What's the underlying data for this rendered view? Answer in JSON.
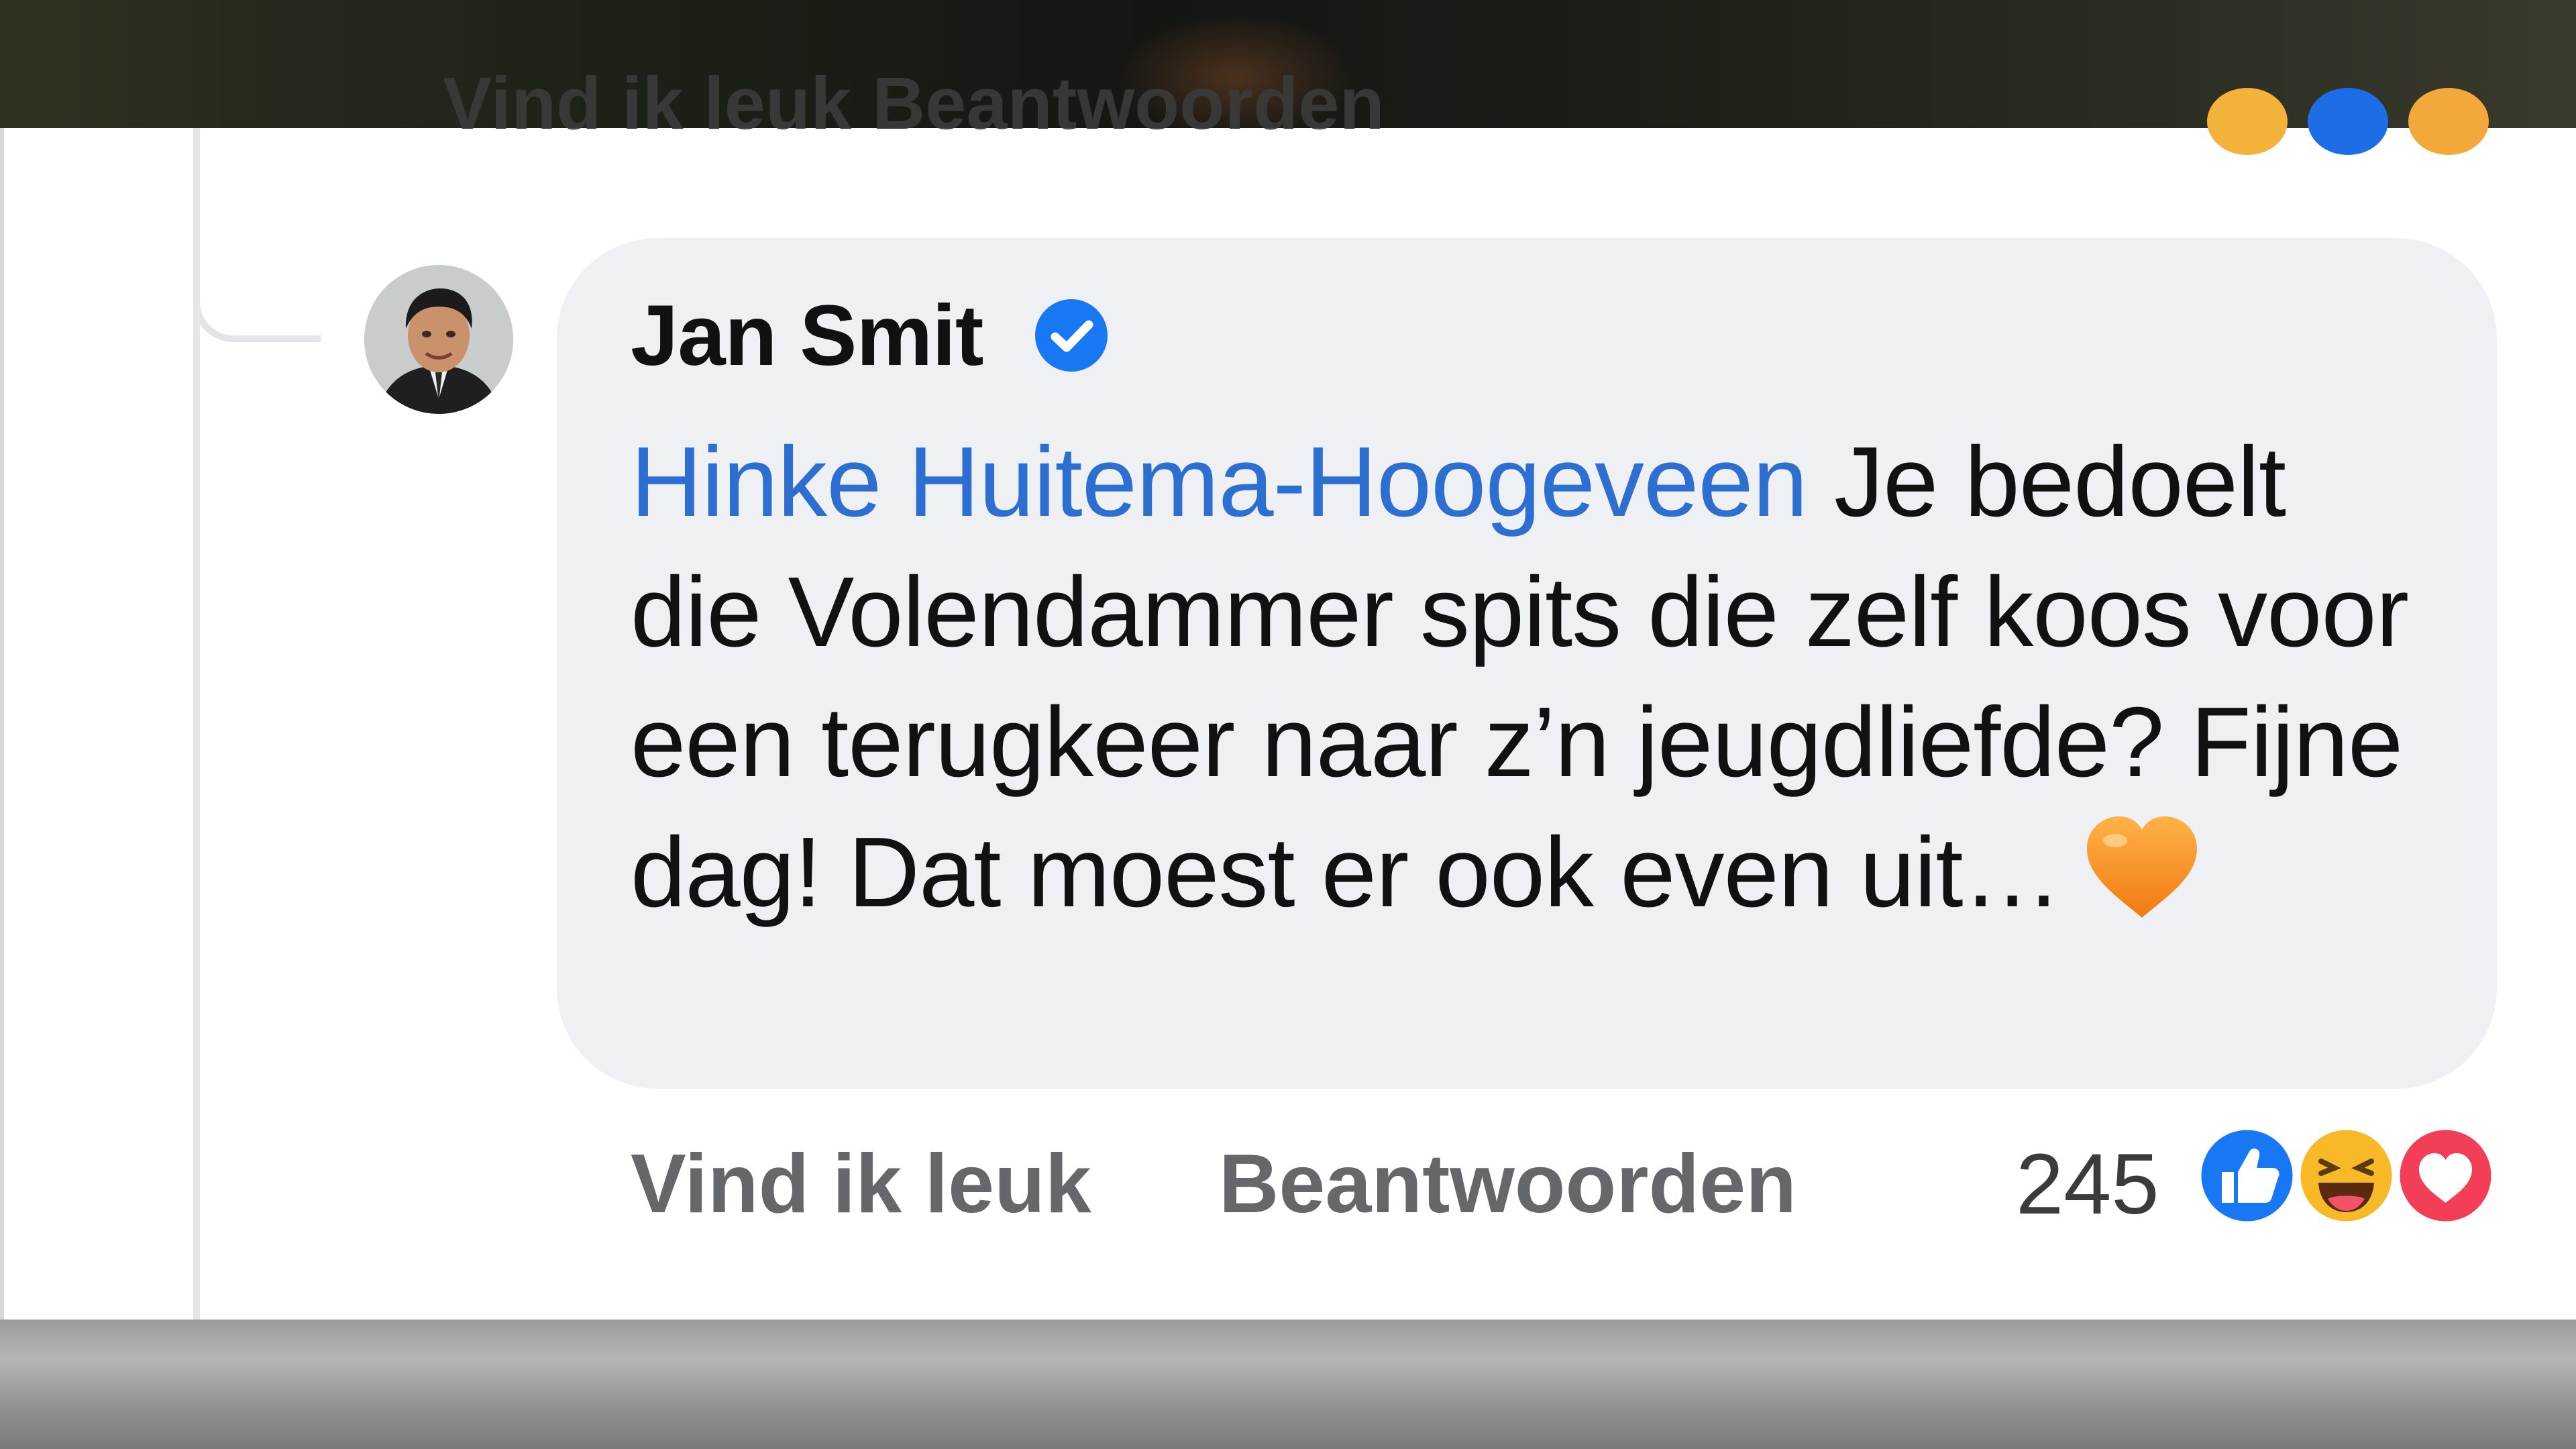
{
  "previous_comment": {
    "actions_partial": "Vind ik leuk   Beantwoorden"
  },
  "comment": {
    "author": "Jan Smit",
    "verified": true,
    "mention": "Hinke Huitema-Hoogeveen",
    "text": " Je bedoelt die Volendammer spits die zelf koos voor een terugkeer naar z’n jeugdliefde? Fijne dag! Dat moest er ook even uit…",
    "trailing_emoji": "orange-heart",
    "actions": {
      "like_label": "Vind ik leuk",
      "reply_label": "Beantwoorden"
    },
    "reaction_count": "245",
    "reactions": [
      "like-icon",
      "haha-icon",
      "love-icon"
    ]
  },
  "colors": {
    "mention": "#2d6fd1",
    "bubble_bg": "#eef0f3",
    "action_text": "#65676b",
    "verified_blue": "#1877f2"
  }
}
